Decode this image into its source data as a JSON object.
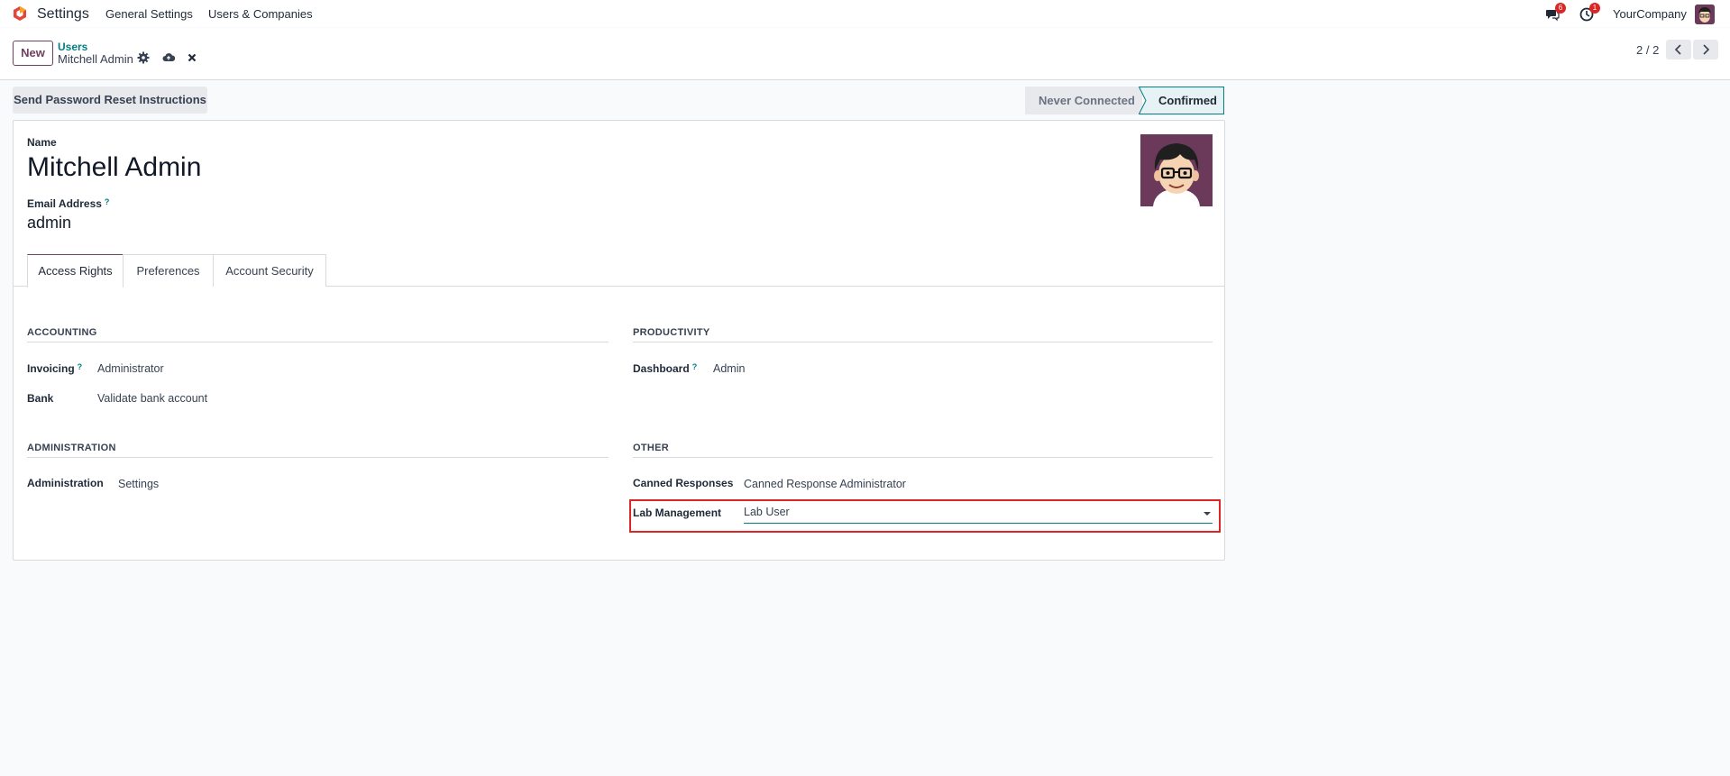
{
  "navbar": {
    "app_name": "Settings",
    "menus": [
      "General Settings",
      "Users & Companies"
    ],
    "messages_badge": "6",
    "activity_badge": "1",
    "company": "YourCompany"
  },
  "control_panel": {
    "new_label": "New",
    "breadcrumb_parent": "Users",
    "breadcrumb_current": "Mitchell Admin",
    "pager_value": "2 / 2"
  },
  "header": {
    "reset_button": "Send Password Reset Instructions",
    "stages": [
      {
        "label": "Never Connected",
        "active": false
      },
      {
        "label": "Confirmed",
        "active": true
      }
    ]
  },
  "form": {
    "name_label": "Name",
    "name_value": "Mitchell Admin",
    "email_label": "Email Address",
    "email_help": "?",
    "email_value": "admin",
    "tabs": [
      "Access Rights",
      "Preferences",
      "Account Security"
    ],
    "active_tab": "Access Rights"
  },
  "access_rights": {
    "accounting": {
      "title": "ACCOUNTING",
      "fields": [
        {
          "label": "Invoicing",
          "help": "?",
          "value": "Administrator"
        },
        {
          "label": "Bank",
          "value": "Validate bank account"
        }
      ]
    },
    "productivity": {
      "title": "PRODUCTIVITY",
      "fields": [
        {
          "label": "Dashboard",
          "help": "?",
          "value": "Admin"
        }
      ]
    },
    "administration": {
      "title": "ADMINISTRATION",
      "fields": [
        {
          "label": "Administration",
          "value": "Settings"
        }
      ]
    },
    "other": {
      "title": "OTHER",
      "fields": [
        {
          "label": "Canned Responses",
          "value": "Canned Response Administrator"
        },
        {
          "label": "Lab Management",
          "value": "Lab User"
        }
      ]
    }
  },
  "colors": {
    "brand": "#71405f",
    "accent": "#017e84",
    "highlight": "#dc2626"
  }
}
